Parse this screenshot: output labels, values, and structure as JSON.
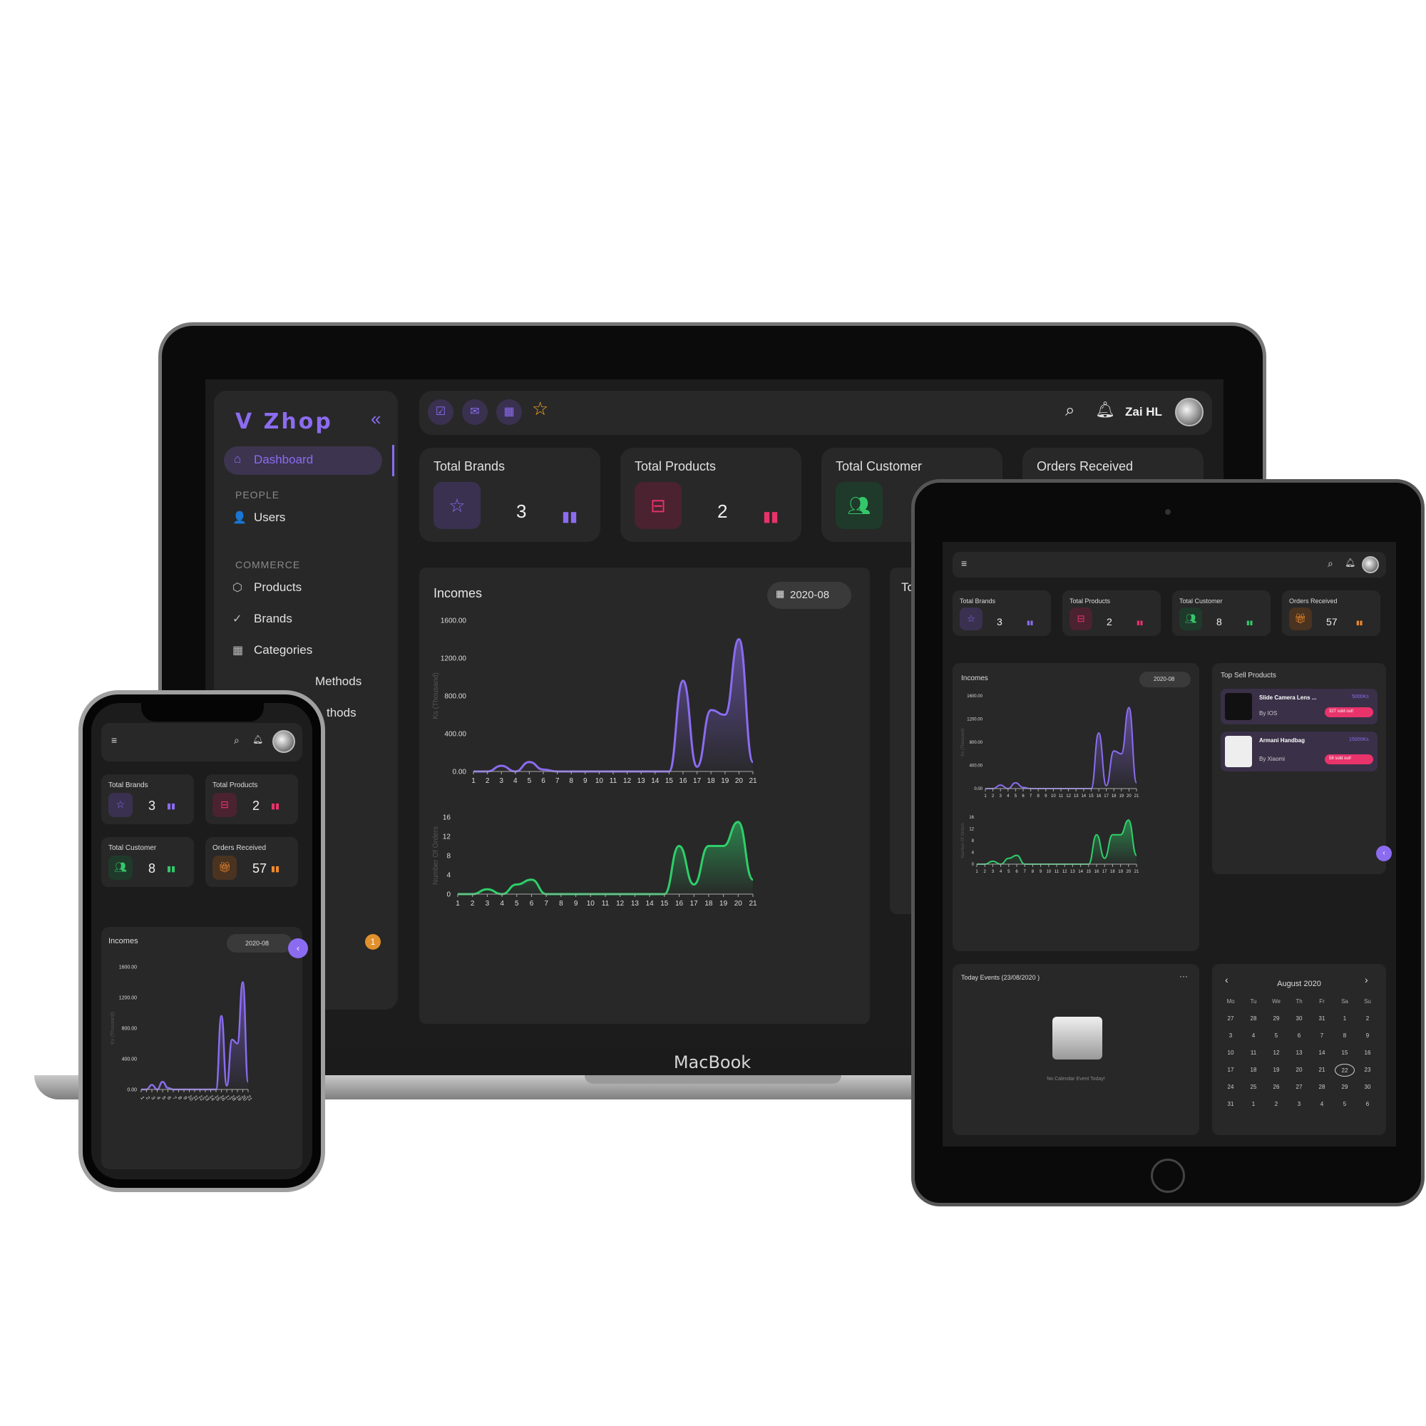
{
  "app": {
    "brand": "Zhop",
    "device_label": "MacBook",
    "user_name": "Zai HL"
  },
  "sidebar": {
    "collapse_icon": "«",
    "active": "Dashboard",
    "sections": [
      {
        "title": "PEOPLE",
        "items": [
          {
            "label": "Users",
            "icon": "user-icon"
          }
        ]
      },
      {
        "title": "COMMERCE",
        "items": [
          {
            "label": "Products",
            "icon": "box-icon"
          },
          {
            "label": "Brands",
            "icon": "check-circle-icon"
          },
          {
            "label": "Categories",
            "icon": "grid-icon"
          },
          {
            "label": "Methods",
            "icon": "card-icon"
          },
          {
            "label": "thods",
            "icon": "card-icon"
          }
        ]
      }
    ],
    "badge": "1"
  },
  "stats": [
    {
      "title": "Total Brands",
      "value": "3",
      "icon": "star-icon",
      "color": "#8b6cf0",
      "bg": "#3a3150"
    },
    {
      "title": "Total Products",
      "value": "2",
      "icon": "bag-icon",
      "color": "#e8336b",
      "bg": "#4a2230"
    },
    {
      "title": "Total Customer",
      "value": "8",
      "icon": "users-icon",
      "color": "#34c76a",
      "bg": "#1f3a2a"
    },
    {
      "title": "Orders Received",
      "value": "57",
      "icon": "gift-icon",
      "color": "#f08a2c",
      "bg": "#4a3320"
    }
  ],
  "incomes": {
    "title": "Incomes",
    "date": "2020-08",
    "ylabel_income": "Ks (Thousand)",
    "ylabel_orders": "Number Of Orders"
  },
  "top_sell": {
    "title": "Top Sell Products",
    "items": [
      {
        "name": "Slide Camera Lens ...",
        "by": "By IOS",
        "price": "5000Ks",
        "sold": "327 sold out!"
      },
      {
        "name": "Armani Handbag",
        "by": "By Xiaomi",
        "price": "15000Ks",
        "sold": "58 sold out!"
      }
    ]
  },
  "events": {
    "title": "Today Events (23/08/2020 )",
    "empty": "No Calendar Event Today!",
    "more": "···"
  },
  "calendar": {
    "month": "August  2020",
    "weekdays": [
      "Mo",
      "Tu",
      "We",
      "Th",
      "Fr",
      "Sa",
      "Su"
    ],
    "days": [
      "27",
      "28",
      "29",
      "30",
      "31",
      "1",
      "2",
      "3",
      "4",
      "5",
      "6",
      "7",
      "8",
      "9",
      "10",
      "11",
      "12",
      "13",
      "14",
      "15",
      "16",
      "17",
      "18",
      "19",
      "20",
      "21",
      "22",
      "23",
      "24",
      "25",
      "26",
      "27",
      "28",
      "29",
      "30",
      "31",
      "1",
      "2",
      "3",
      "4",
      "5",
      "6"
    ],
    "today": "23"
  },
  "chart_data": [
    {
      "type": "area",
      "title": "Incomes",
      "ylabel": "Ks (Thousand)",
      "x": [
        1,
        2,
        3,
        4,
        5,
        6,
        7,
        8,
        9,
        10,
        11,
        12,
        13,
        14,
        15,
        16,
        17,
        18,
        19,
        20,
        21
      ],
      "values": [
        0,
        0,
        60,
        0,
        100,
        20,
        0,
        0,
        0,
        0,
        0,
        0,
        0,
        0,
        0,
        960,
        50,
        650,
        600,
        1400,
        100
      ],
      "yticks": [
        "0.00",
        "400.00",
        "800.00",
        "1200.00",
        "1600.00"
      ],
      "ylim": [
        0,
        1600
      ],
      "color": "#8b6cf0"
    },
    {
      "type": "area",
      "ylabel": "Number Of Orders",
      "x": [
        1,
        2,
        3,
        4,
        5,
        6,
        7,
        8,
        9,
        10,
        11,
        12,
        13,
        14,
        15,
        16,
        17,
        18,
        19,
        20,
        21
      ],
      "values": [
        0,
        0,
        1,
        0,
        2,
        3,
        0,
        0,
        0,
        0,
        0,
        0,
        0,
        0,
        0,
        10,
        2,
        10,
        10,
        15,
        3
      ],
      "yticks": [
        "0",
        "4",
        "8",
        "12",
        "16"
      ],
      "ylim": [
        0,
        16
      ],
      "color": "#2fcf6a"
    }
  ]
}
